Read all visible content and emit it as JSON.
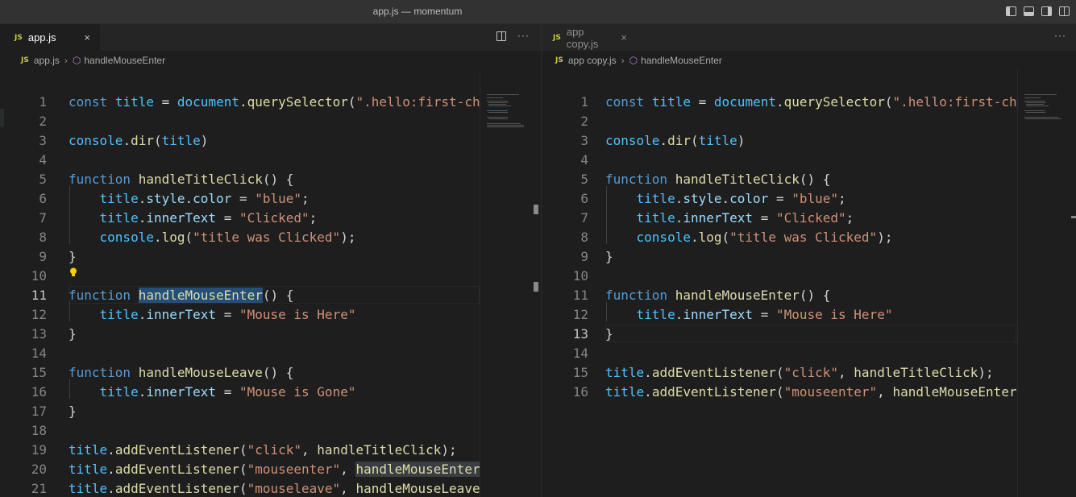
{
  "window": {
    "title": "app.js — momentum"
  },
  "colors": {
    "background": "#1e1e1e",
    "tab_active": "#1e1e1e",
    "tab_inactive": "#252526",
    "keyword": "#569cd6",
    "string": "#ce9178",
    "function": "#dcdcaa",
    "variable": "#4fc1ff"
  },
  "left_editor": {
    "tab": {
      "icon": "JS",
      "label": "app.js",
      "close": "×"
    },
    "actions": {
      "split": "split-editor-icon",
      "more": "···"
    },
    "breadcrumb": {
      "icon": "JS",
      "file": "app.js",
      "separator": "›",
      "symbol_icon": "⬡",
      "symbol": "handleMouseEnter"
    },
    "lines": [
      {
        "n": "1"
      },
      {
        "n": "2"
      },
      {
        "n": "3"
      },
      {
        "n": "4"
      },
      {
        "n": "5"
      },
      {
        "n": "6"
      },
      {
        "n": "7"
      },
      {
        "n": "8"
      },
      {
        "n": "9"
      },
      {
        "n": "10"
      },
      {
        "n": "11"
      },
      {
        "n": "12"
      },
      {
        "n": "13"
      },
      {
        "n": "14"
      },
      {
        "n": "15"
      },
      {
        "n": "16"
      },
      {
        "n": "17"
      },
      {
        "n": "18"
      },
      {
        "n": "19"
      },
      {
        "n": "20"
      },
      {
        "n": "21"
      }
    ],
    "active_line": "11",
    "code": {
      "l1": [
        "const",
        "title",
        "=",
        "document",
        ".",
        "querySelector",
        "(",
        "\".hello:first-ch"
      ],
      "l3": [
        "console",
        ".",
        "dir",
        "(",
        "title",
        ")"
      ],
      "l5": [
        "function",
        "handleTitleClick",
        "() {"
      ],
      "l6": [
        "title",
        ".",
        "style",
        ".",
        "color",
        "=",
        "\"blue\"",
        ";"
      ],
      "l7": [
        "title",
        ".",
        "innerText",
        "=",
        "\"Clicked\"",
        ";"
      ],
      "l8": [
        "console",
        ".",
        "log",
        "(",
        "\"title was Clicked\"",
        ");"
      ],
      "l9": [
        "}"
      ],
      "l11": [
        "function",
        "handleMouseEnter",
        "() {"
      ],
      "l12": [
        "title",
        ".",
        "innerText",
        "=",
        "\"Mouse is Here\""
      ],
      "l13": [
        "}"
      ],
      "l15": [
        "function",
        "handleMouseLeave",
        "() {"
      ],
      "l16": [
        "title",
        ".",
        "innerText",
        "=",
        "\"Mouse is Gone\""
      ],
      "l17": [
        "}"
      ],
      "l19": [
        "title",
        ".",
        "addEventListener",
        "(",
        "\"click\"",
        ",",
        "handleTitleClick",
        ");"
      ],
      "l20": [
        "title",
        ".",
        "addEventListener",
        "(",
        "\"mouseenter\"",
        ",",
        "handleMouseEnter"
      ],
      "l21": [
        "title",
        ".",
        "addEventListener",
        "(",
        "\"mouseleave\"",
        ",",
        "handleMouseLeave"
      ]
    }
  },
  "right_editor": {
    "tab": {
      "icon": "JS",
      "label": "app copy.js",
      "close": "×"
    },
    "actions": {
      "more": "···"
    },
    "breadcrumb": {
      "icon": "JS",
      "file": "app copy.js",
      "separator": "›",
      "symbol_icon": "⬡",
      "symbol": "handleMouseEnter"
    },
    "lines": [
      {
        "n": "1"
      },
      {
        "n": "2"
      },
      {
        "n": "3"
      },
      {
        "n": "4"
      },
      {
        "n": "5"
      },
      {
        "n": "6"
      },
      {
        "n": "7"
      },
      {
        "n": "8"
      },
      {
        "n": "9"
      },
      {
        "n": "10"
      },
      {
        "n": "11"
      },
      {
        "n": "12"
      },
      {
        "n": "13"
      },
      {
        "n": "14"
      },
      {
        "n": "15"
      },
      {
        "n": "16"
      }
    ],
    "active_line": "13",
    "code": {
      "l1": [
        "const",
        "title",
        "=",
        "document",
        ".",
        "querySelector",
        "(",
        "\".hello:first-ch"
      ],
      "l3": [
        "console",
        ".",
        "dir",
        "(",
        "title",
        ")"
      ],
      "l5": [
        "function",
        "handleTitleClick",
        "() {"
      ],
      "l6": [
        "title",
        ".",
        "style",
        ".",
        "color",
        "=",
        "\"blue\"",
        ";"
      ],
      "l7": [
        "title",
        ".",
        "innerText",
        "=",
        "\"Clicked\"",
        ";"
      ],
      "l8": [
        "console",
        ".",
        "log",
        "(",
        "\"title was Clicked\"",
        ");"
      ],
      "l9": [
        "}"
      ],
      "l11": [
        "function",
        "handleMouseEnter",
        "() {"
      ],
      "l12": [
        "title",
        ".",
        "innerText",
        "=",
        "\"Mouse is Here\""
      ],
      "l13": [
        "}"
      ],
      "l15": [
        "title",
        ".",
        "addEventListener",
        "(",
        "\"click\"",
        ",",
        "handleTitleClick",
        ");"
      ],
      "l16": [
        "title",
        ".",
        "addEventListener",
        "(",
        "\"mouseenter\"",
        ",",
        "handleMouseEnter"
      ]
    }
  }
}
